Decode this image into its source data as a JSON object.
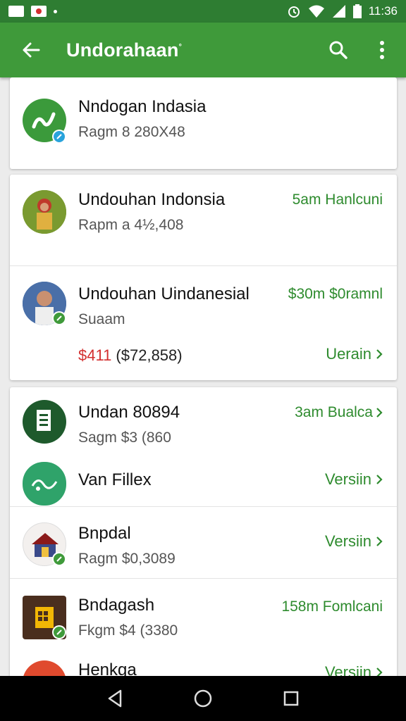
{
  "status": {
    "time": "11:36"
  },
  "app_bar": {
    "title": "Undorahaan",
    "title_mark": "°"
  },
  "rows": [
    {
      "title": "Nndogan Indasia",
      "sub": "Ragm 8 280X48",
      "meta": "",
      "link": ""
    },
    {
      "title": "Undouhan Indonsia",
      "sub": "Rapm a 4½,408",
      "meta": "5am Hanlcuni",
      "link": ""
    },
    {
      "title": "Undouhan Uindanesial",
      "sub": "Suaam",
      "meta": "$30m $0ramnl",
      "price_red": "$411",
      "price_rest": " ($72,858)",
      "link": "Uerain"
    },
    {
      "title": "Undan 80894",
      "sub": "Sagm $3 (860",
      "meta": "3am Bualca",
      "link": ""
    },
    {
      "title": "Van Fillex",
      "sub": "",
      "meta": "",
      "link": "Versiin"
    },
    {
      "title": "Bnpdal",
      "sub": "Ragm $0,3089",
      "meta": "",
      "link": "Versiin"
    },
    {
      "title": "Bndagash",
      "sub": "Fkgm $4 (3380",
      "meta": "158m Fomlcani",
      "link": ""
    },
    {
      "title": "Henkga",
      "sub": "",
      "meta": "",
      "link": "Versiin"
    }
  ]
}
